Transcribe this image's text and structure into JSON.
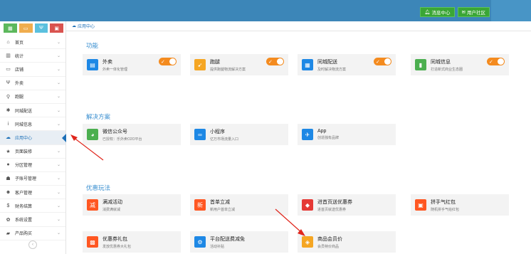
{
  "topbar": {
    "message_center": "消息中心",
    "user_community": "用户社区"
  },
  "quick_buttons": [
    {
      "icon": "chart-icon",
      "color": "#5cb85c",
      "glyph": "▦"
    },
    {
      "icon": "monitor-icon",
      "color": "#f0ad4e",
      "glyph": "▭"
    },
    {
      "icon": "fork-icon",
      "color": "#5bc0de",
      "glyph": "Ψ"
    },
    {
      "icon": "bag-icon",
      "color": "#d9534f",
      "glyph": "▣"
    }
  ],
  "sidebar": {
    "items": [
      {
        "label": "首页",
        "icon": "home-icon",
        "glyph": "⌂"
      },
      {
        "label": "统计",
        "icon": "bar-chart-icon",
        "glyph": "▥"
      },
      {
        "label": "店铺",
        "icon": "monitor-icon",
        "glyph": "▭"
      },
      {
        "label": "外卖",
        "icon": "fork-icon",
        "glyph": "Ψ"
      },
      {
        "label": "跑腿",
        "icon": "bike-icon",
        "glyph": "⚲"
      },
      {
        "label": "同城配送",
        "icon": "asterisk-icon",
        "glyph": "✱"
      },
      {
        "label": "同城信息",
        "icon": "info-icon",
        "glyph": "i"
      },
      {
        "label": "应用中心",
        "icon": "cloud-icon",
        "glyph": "☁",
        "active": true
      },
      {
        "label": "页面装修",
        "icon": "star-icon",
        "glyph": "★"
      },
      {
        "label": "分区管理",
        "icon": "circle-icon",
        "glyph": "●"
      },
      {
        "label": "子账号管理",
        "icon": "user-icon",
        "glyph": "☗"
      },
      {
        "label": "客户管理",
        "icon": "users-icon",
        "glyph": "☻"
      },
      {
        "label": "财务结算",
        "icon": "dollar-icon",
        "glyph": "$"
      },
      {
        "label": "系统设置",
        "icon": "gear-icon",
        "glyph": "✿"
      },
      {
        "label": "产品购买",
        "icon": "cart-icon",
        "glyph": "▰"
      }
    ],
    "collapse": "‹"
  },
  "breadcrumb": "应用中心",
  "sections": {
    "features": "功能",
    "solutions": "解决方案",
    "promotions": "优惠玩法"
  },
  "cards": {
    "waimai": {
      "name": "外卖",
      "desc": "外卖一体化管理",
      "color": "#1e88e5",
      "icon": "store-icon",
      "glyph": "▤"
    },
    "paotui": {
      "name": "跑腿",
      "desc": "提供跑腿物流解决方案",
      "color": "#f5a623",
      "icon": "courier-icon",
      "glyph": "➹"
    },
    "peisong": {
      "name": "同城配送",
      "desc": "及时解决物流方案",
      "color": "#1e88e5",
      "icon": "delivery-icon",
      "glyph": "▦"
    },
    "xinxi": {
      "name": "同城信息",
      "desc": "打造新式商业生态圈",
      "color": "#4caf50",
      "icon": "building-icon",
      "glyph": "▮"
    },
    "wechat": {
      "name": "微信公众号",
      "desc": "已授权：乐外卖O2O平台",
      "color": "#4caf50",
      "icon": "wechat-icon",
      "glyph": "◕"
    },
    "miniapp": {
      "name": "小程序",
      "desc": "亿万市场流量入口",
      "color": "#1e88e5",
      "icon": "miniapp-icon",
      "glyph": "∞"
    },
    "app": {
      "name": "App",
      "desc": "创造独有品牌",
      "color": "#1e88e5",
      "icon": "app-icon",
      "glyph": "✈"
    },
    "manjian": {
      "name": "满减活动",
      "desc": "消费满就减",
      "color": "#ff5722",
      "icon": "discount-icon",
      "glyph": "减"
    },
    "shoudan": {
      "name": "首单立减",
      "desc": "新用户首单立减",
      "color": "#ff5722",
      "icon": "first-order-icon",
      "glyph": "新"
    },
    "jindian": {
      "name": "进首页送优惠券",
      "desc": "进首页就送优惠券",
      "color": "#e53935",
      "icon": "coupon-icon",
      "glyph": "◆"
    },
    "pinshou": {
      "name": "拼手气红包",
      "desc": "随机拼手气给红包",
      "color": "#ff5722",
      "icon": "red-packet-icon",
      "glyph": "▣"
    },
    "coupon_pack": {
      "name": "优惠券礼包",
      "desc": "发放优惠券大礼包",
      "color": "#ff5722",
      "icon": "gift-icon",
      "glyph": "▩"
    },
    "platform": {
      "name": "平台配送费减免",
      "desc": "活动补贴",
      "color": "#1e88e5",
      "icon": "scooter-icon",
      "glyph": "⚙"
    },
    "member": {
      "name": "商品会员价",
      "desc": "会员特价商品",
      "color": "#f5a623",
      "icon": "diamond-icon",
      "glyph": "◈"
    }
  },
  "toggle_label": "✓"
}
